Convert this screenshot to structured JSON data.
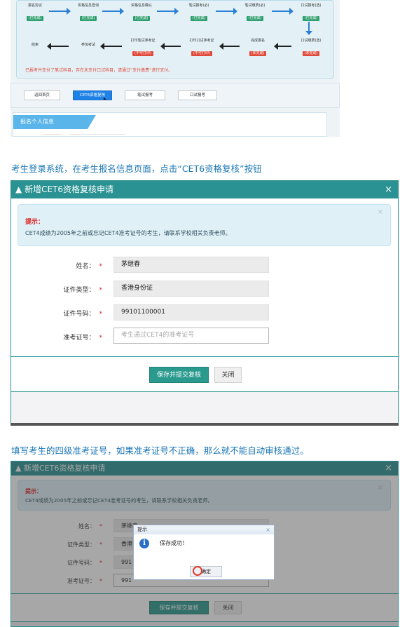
{
  "flow": {
    "row1": [
      {
        "title": "报名协议",
        "status": "(已完成)",
        "state": "ok"
      },
      {
        "title": "资格信息查询",
        "status": "(已完成)",
        "state": "ok"
      },
      {
        "title": "资格信息确认",
        "status": "(已完成)",
        "state": "ok"
      },
      {
        "title": "笔试报考(必)",
        "status": "(已完成)",
        "state": "ok"
      },
      {
        "title": "笔试缴费(必)",
        "status": "(已完成)",
        "state": "ok"
      },
      {
        "title": "口试报考(选)",
        "status": "(已完成)",
        "state": "ok"
      }
    ],
    "row2": [
      {
        "title": "结束",
        "status": "",
        "state": "none"
      },
      {
        "title": "参加考试",
        "status": "",
        "state": "none"
      },
      {
        "title": "打印笔试准考证",
        "status": "(不可打印)",
        "state": "bad"
      },
      {
        "title": "打印口试准考证",
        "status": "(不可打印)",
        "state": "bad"
      },
      {
        "title": "完成报名",
        "status": "(未完成)",
        "state": "bad"
      },
      {
        "title": "口试缴费(选)",
        "status": "(未完成)",
        "state": "bad"
      }
    ],
    "note": "已报考并支付了笔试科目，存在未支付口试科目，请通过“支付缴费”进行支付。",
    "nav": [
      "返回首页",
      "CET6资格复核",
      "笔试报考",
      "口试报考"
    ],
    "panel_title": "报名个人信息",
    "colors": {
      "ok": "#2e9e6e",
      "bad": "#e04a3a",
      "accent": "#1e82e6"
    }
  },
  "caption1": "考生登录系统，在考生报名信息页面，点击“CET6资格复核”按钮",
  "caption2": "填写考生的四级准考证号，如果准考证号不正确，那么就不能自动审核通过。",
  "dialog": {
    "title": "新增CET6资格复核申请",
    "close": "×",
    "tip_title": "提示：",
    "tip_text": "CET4成绩为2005年之前或忘记CET4准考证号的考生，请联系学校相关负责老师。",
    "tip_close": "×",
    "fields": [
      {
        "label": "姓名：",
        "value": "茅继春"
      },
      {
        "label": "证件类型：",
        "value": "香港身份证"
      },
      {
        "label": "证件号码：",
        "value": "99101100001"
      },
      {
        "label": "准考证号：",
        "value": ""
      }
    ],
    "required_mark": "*",
    "placeholder": "考生通过CET4的准考证号",
    "save_label": "保存并提交复核",
    "close_label": "关闭"
  },
  "dialog2": {
    "values": [
      "茅继春",
      "香港",
      "991",
      "991"
    ]
  },
  "alert": {
    "title": "提示",
    "close": "×",
    "message": "保存成功！",
    "ok_label": "确定",
    "icon": "info-icon"
  }
}
